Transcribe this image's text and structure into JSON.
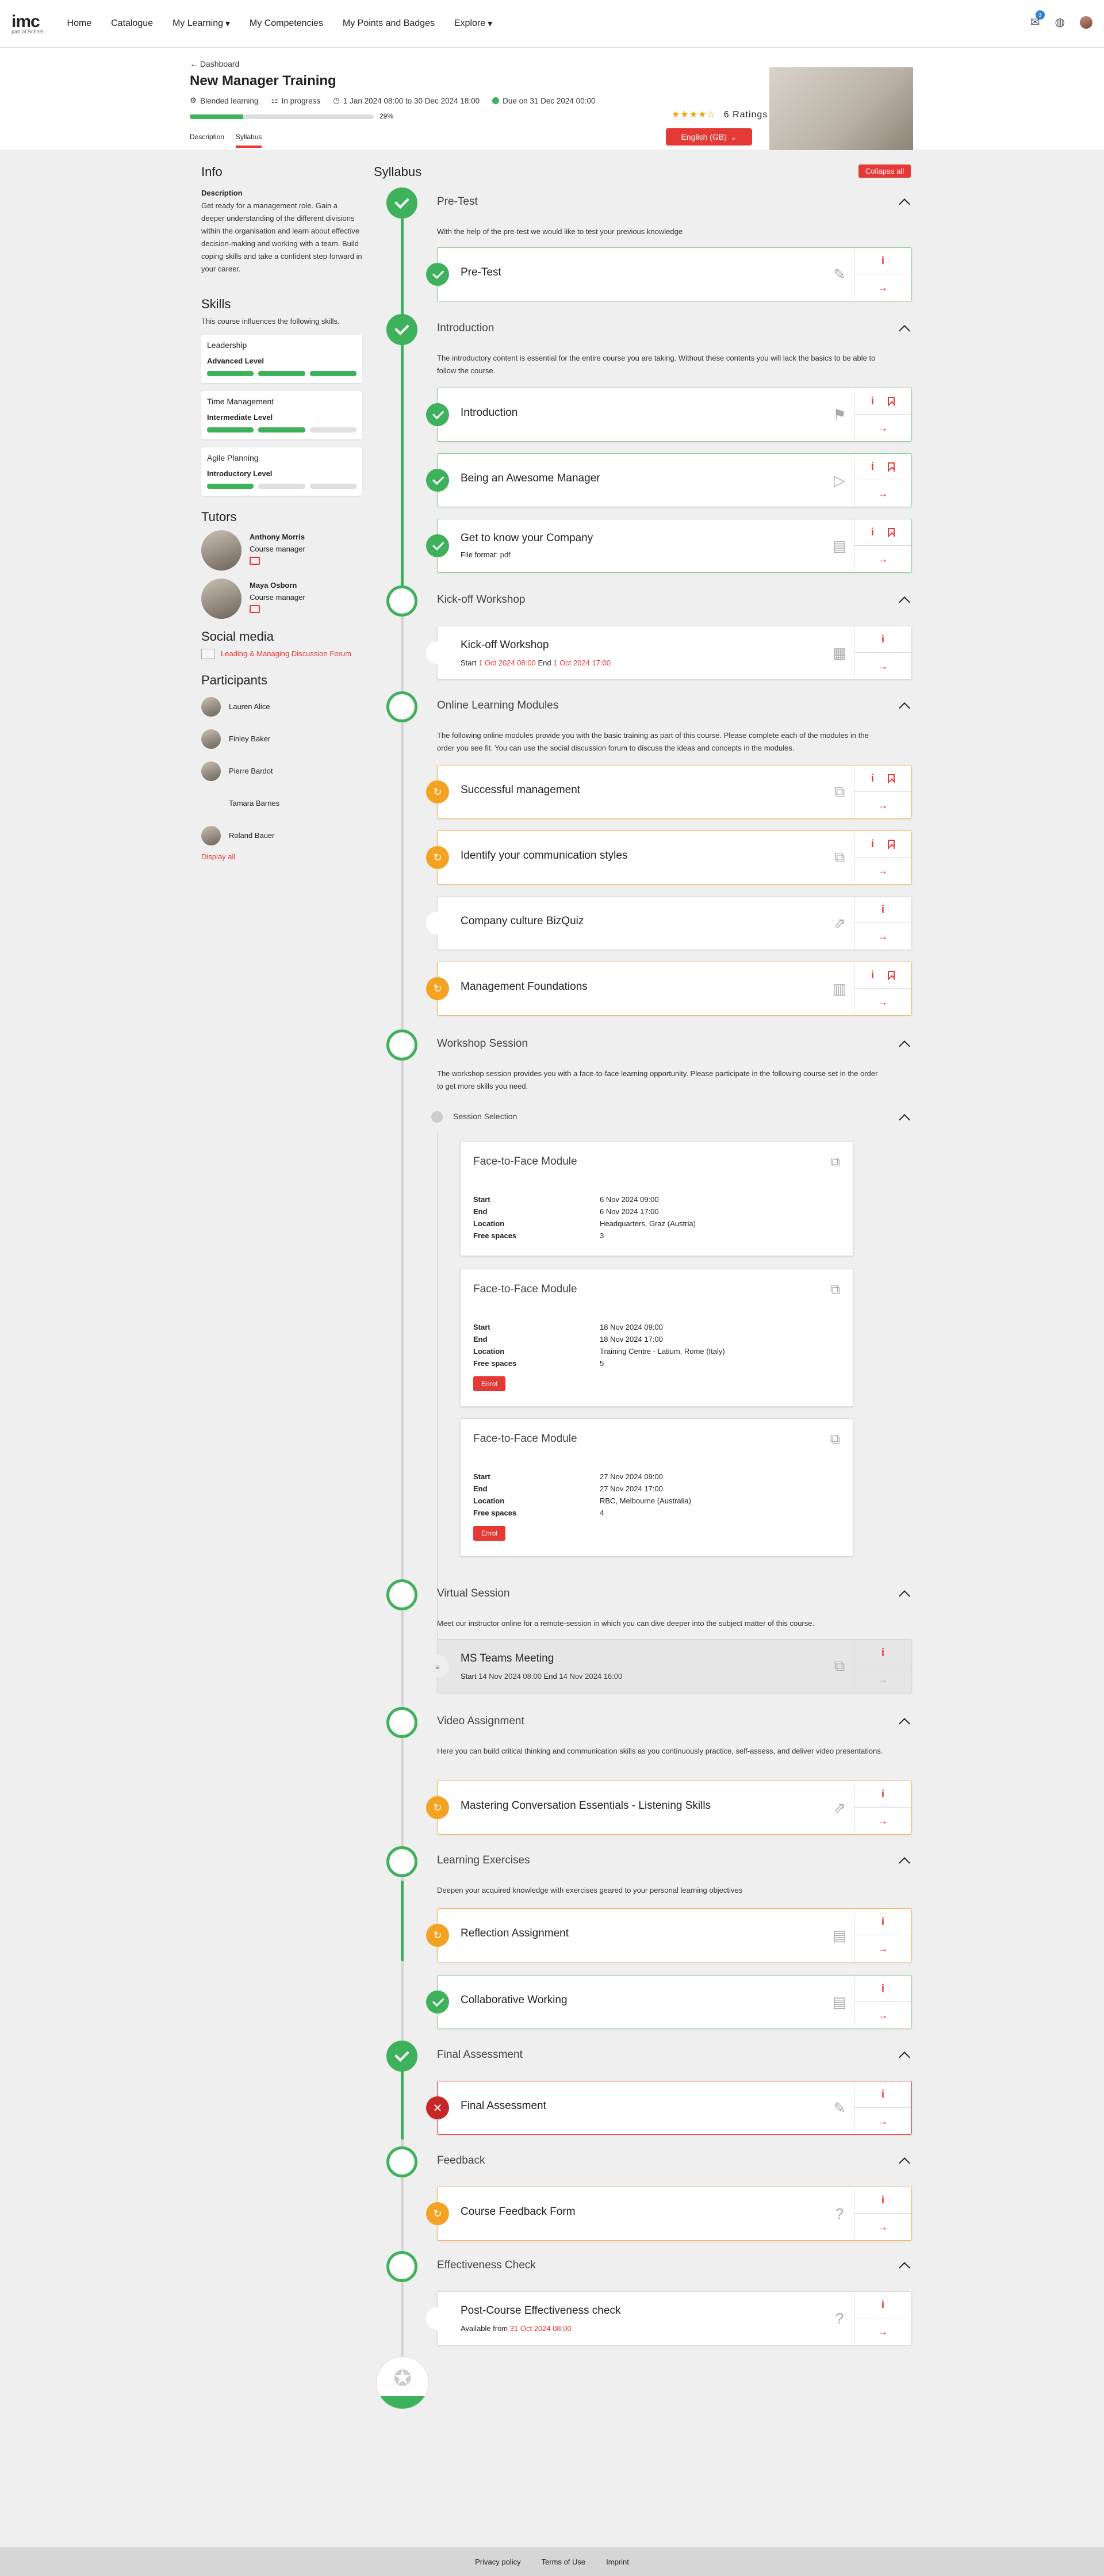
{
  "nav": {
    "logo": "imc",
    "logo_sub": "part of Scheer",
    "items": [
      "Home",
      "Catalogue",
      "My Learning",
      "My Competencies",
      "My Points and Badges",
      "Explore"
    ],
    "mail_count": "3"
  },
  "header": {
    "breadcrumb": "Dashboard",
    "title": "New Manager Training",
    "type": "Blended learning",
    "status": "In progress",
    "dates": "1 Jan 2024 08:00 to 30 Dec 2024 18:00",
    "due": "Due on 31 Dec 2024 00:00",
    "progress": 0.29,
    "progress_label": "29%",
    "tabs": [
      "Description",
      "Syllabus"
    ],
    "rating_stars": "★★★★☆",
    "ratings": "6 Ratings",
    "language": "English (GB)"
  },
  "info": {
    "heading": "Info",
    "desc_label": "Description",
    "desc": "Get ready for a management role. Gain a deeper understanding of the different divisions within the organisation and learn about effective decision-making and working with a team. Build coping skills and take a confident step forward in your career."
  },
  "skills": {
    "heading": "Skills",
    "intro": "This course influences the following skills.",
    "items": [
      {
        "name": "Leadership",
        "level": "Advanced Level",
        "filled": 3
      },
      {
        "name": "Time Management",
        "level": "Intermediate Level",
        "filled": 2
      },
      {
        "name": "Agile Planning",
        "level": "Introductory Level",
        "filled": 1
      }
    ]
  },
  "tutors": {
    "heading": "Tutors",
    "items": [
      {
        "name": "Anthony Morris",
        "role": "Course manager"
      },
      {
        "name": "Maya Osborn",
        "role": "Course manager"
      }
    ]
  },
  "social": {
    "heading": "Social media",
    "forum": "Leading & Managing Discussion Forum"
  },
  "participants": {
    "heading": "Participants",
    "items": [
      "Lauren Alice",
      "Finley Baker",
      "Pierre Bardot",
      "Tamara Barnes",
      "Roland Bauer"
    ],
    "display_all": "Display all"
  },
  "syllabus": {
    "heading": "Syllabus",
    "collapse": "Collapse all"
  },
  "sections": {
    "s1": {
      "title": "Pre-Test",
      "desc": "With the help of the pre-test we would like to test your previous knowledge"
    },
    "s2": {
      "title": "Introduction",
      "desc": "The introductory content is essential for the entire course you are taking. Without these contents you will lack the basics to be able to follow the course."
    },
    "s3": {
      "title": "Kick-off Workshop"
    },
    "s4": {
      "title": "Online Learning Modules",
      "desc": "The following online modules provide you with the basic training as part of this course. Please complete each of the modules in the order you see fit. You can use the social discussion forum to discuss the ideas and concepts in the modules."
    },
    "s5": {
      "title": "Workshop Session",
      "desc": "The workshop session provides you with a face-to-face learning opportunity. Please participate in the following course set in the order to get more skills you need.",
      "sub": "Session Selection"
    },
    "s6": {
      "title": "Virtual Session",
      "desc": "Meet our instructor online for a remote-session in which you can dive deeper into the subject matter of this course."
    },
    "s7": {
      "title": "Video Assignment",
      "desc": "Here you can build critical thinking and communication skills as you continuously practice, self-assess, and deliver video presentations."
    },
    "s8": {
      "title": "Learning Exercises",
      "desc": "Deepen your acquired knowledge with exercises geared to your personal learning objectives"
    },
    "s9": {
      "title": "Final Assessment"
    },
    "s10": {
      "title": "Feedback"
    },
    "s11": {
      "title": "Effectiveness Check"
    }
  },
  "cards": {
    "pretest": "Pre-Test",
    "intro": "Introduction",
    "awesome": "Being an Awesome Manager",
    "company": "Get to know your Company",
    "company_sub_label": "File format:",
    "company_sub_val": "pdf",
    "kickoff": "Kick-off Workshop",
    "start_label": "Start",
    "end_label": "End",
    "kickoff_start": "1 Oct 2024 08:00",
    "kickoff_end": "1 Oct 2024 17:00",
    "successful": "Successful management",
    "comm": "Identify your communication styles",
    "bizquiz": "Company culture BizQuiz",
    "foundations": "Management Foundations",
    "teams": "MS Teams Meeting",
    "teams_start": "14 Nov 2024 08:00",
    "teams_end": "14 Nov 2024 16:00",
    "mastering": "Mastering Conversation Essentials - Listening Skills",
    "reflection": "Reflection Assignment",
    "collab": "Collaborative Working",
    "final": "Final Assessment",
    "feedback": "Course Feedback Form",
    "postcourse": "Post-Course Effectiveness check",
    "avail_label": "Available from",
    "avail_val": "31 Oct 2024 08:00"
  },
  "sessions": {
    "title": "Face-to-Face Module",
    "labels": [
      "Start",
      "End",
      "Location",
      "Free spaces"
    ],
    "enroll": "Enrol",
    "items": [
      {
        "start": "6 Nov 2024 09:00",
        "end": "6 Nov 2024 17:00",
        "location": "Headquarters, Graz (Austria)",
        "free": "3"
      },
      {
        "start": "18 Nov 2024 09:00",
        "end": "18 Nov 2024 17:00",
        "location": "Training Centre - Latium, Rome (Italy)",
        "free": "5"
      },
      {
        "start": "27 Nov 2024 09:00",
        "end": "27 Nov 2024 17:00",
        "location": "RBC, Melbourne (Australia)",
        "free": "4"
      }
    ]
  },
  "footer": [
    "Privacy policy",
    "Terms of Use",
    "Imprint"
  ],
  "colors": {
    "accent": "#e53935",
    "success": "#3eb15b",
    "warning": "#f3a321"
  }
}
